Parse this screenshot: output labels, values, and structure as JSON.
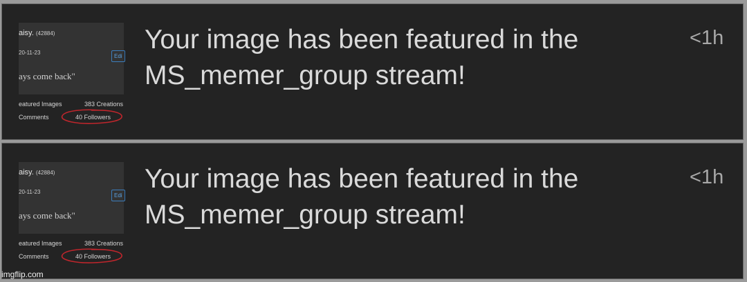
{
  "notifications": [
    {
      "message": "Your image has been featured in the MS_memer_group stream!",
      "time": "<1h",
      "thumbnail": {
        "username": "aisy.",
        "user_id": "(42884)",
        "date": "20-11-23",
        "edit_label": "Edi",
        "quote": "ays come back\"",
        "featured_images_label": "eatured Images",
        "creations_label": "383 Creations",
        "comments_label": "Comments",
        "followers_label": "40 Followers",
        "highlight_color": "#c0262c"
      }
    },
    {
      "message": "Your image has been featured in the MS_memer_group stream!",
      "time": "<1h",
      "thumbnail": {
        "username": "aisy.",
        "user_id": "(42884)",
        "date": "20-11-23",
        "edit_label": "Edi",
        "quote": "ays come back\"",
        "featured_images_label": "eatured Images",
        "creations_label": "383 Creations",
        "comments_label": "Comments",
        "followers_label": "40 Followers",
        "highlight_color": "#c0262c"
      }
    }
  ],
  "watermark": "imgflip.com"
}
